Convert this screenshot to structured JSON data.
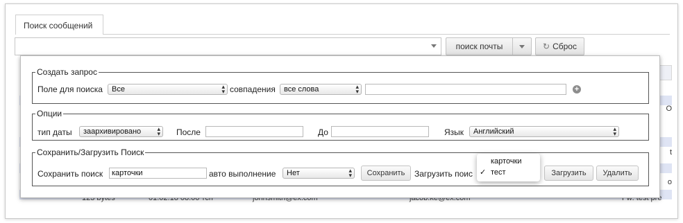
{
  "tabs": [
    {
      "label": "Поиск сообщений"
    }
  ],
  "toolbar": {
    "search_value": "",
    "search_mail_label": "поиск почты",
    "reset_label": "Сброс"
  },
  "create_query": {
    "legend": "Создать запрос",
    "field_label": "Поле для поиска",
    "field_value": "Все",
    "match_label": "совпадения",
    "match_value": "все слова",
    "query_value": ""
  },
  "options": {
    "legend": "Опции",
    "date_type_label": "тип даты",
    "date_type_value": "заархивировано",
    "after_label": "После",
    "after_value": "",
    "before_label": "До",
    "before_value": "",
    "language_label": "Язык",
    "language_value": "Английский"
  },
  "save_load": {
    "legend": "Сохранить/Загрузить Поиск",
    "save_label": "Сохранить поиск",
    "save_value": "карточки",
    "auto_label": "авто выполнение",
    "auto_value": "Нет",
    "save_button": "Сохранить",
    "load_label": "Загрузить поис",
    "load_button": "Загрузить",
    "delete_button": "Удалить",
    "load_options": [
      {
        "label": "карточки",
        "selected": false
      },
      {
        "label": "тест",
        "selected": true
      }
    ]
  },
  "background_table": {
    "right_letters": [
      "O",
      "t",
      "o"
    ],
    "bottom_row": [
      "123 bytes",
      "01.02.18 08:00 тсп",
      "johnsmith@ex.com",
      "jacob.ke@ex.com",
      "Fw: test pre"
    ]
  }
}
